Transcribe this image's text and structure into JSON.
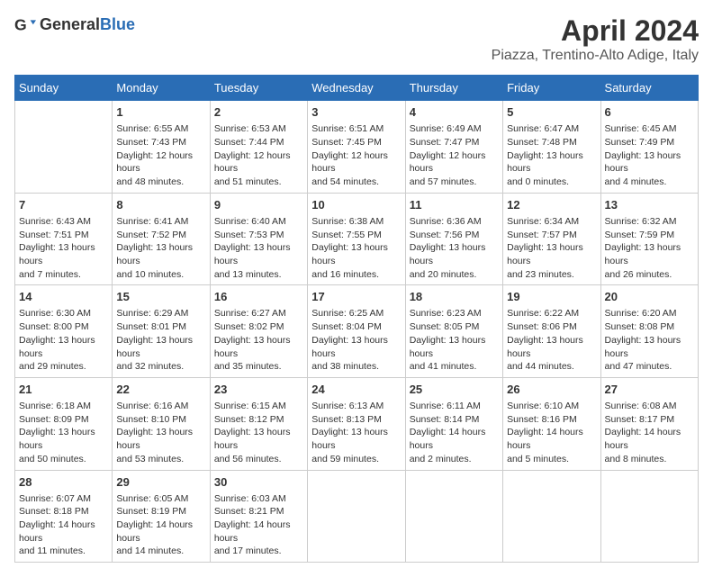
{
  "logo": {
    "general": "General",
    "blue": "Blue"
  },
  "title": "April 2024",
  "location": "Piazza, Trentino-Alto Adige, Italy",
  "days_of_week": [
    "Sunday",
    "Monday",
    "Tuesday",
    "Wednesday",
    "Thursday",
    "Friday",
    "Saturday"
  ],
  "weeks": [
    [
      {
        "day": null,
        "info": null
      },
      {
        "day": "1",
        "info": "Sunrise: 6:55 AM\nSunset: 7:43 PM\nDaylight: 12 hours and 48 minutes."
      },
      {
        "day": "2",
        "info": "Sunrise: 6:53 AM\nSunset: 7:44 PM\nDaylight: 12 hours and 51 minutes."
      },
      {
        "day": "3",
        "info": "Sunrise: 6:51 AM\nSunset: 7:45 PM\nDaylight: 12 hours and 54 minutes."
      },
      {
        "day": "4",
        "info": "Sunrise: 6:49 AM\nSunset: 7:47 PM\nDaylight: 12 hours and 57 minutes."
      },
      {
        "day": "5",
        "info": "Sunrise: 6:47 AM\nSunset: 7:48 PM\nDaylight: 13 hours and 0 minutes."
      },
      {
        "day": "6",
        "info": "Sunrise: 6:45 AM\nSunset: 7:49 PM\nDaylight: 13 hours and 4 minutes."
      }
    ],
    [
      {
        "day": "7",
        "info": "Sunrise: 6:43 AM\nSunset: 7:51 PM\nDaylight: 13 hours and 7 minutes."
      },
      {
        "day": "8",
        "info": "Sunrise: 6:41 AM\nSunset: 7:52 PM\nDaylight: 13 hours and 10 minutes."
      },
      {
        "day": "9",
        "info": "Sunrise: 6:40 AM\nSunset: 7:53 PM\nDaylight: 13 hours and 13 minutes."
      },
      {
        "day": "10",
        "info": "Sunrise: 6:38 AM\nSunset: 7:55 PM\nDaylight: 13 hours and 16 minutes."
      },
      {
        "day": "11",
        "info": "Sunrise: 6:36 AM\nSunset: 7:56 PM\nDaylight: 13 hours and 20 minutes."
      },
      {
        "day": "12",
        "info": "Sunrise: 6:34 AM\nSunset: 7:57 PM\nDaylight: 13 hours and 23 minutes."
      },
      {
        "day": "13",
        "info": "Sunrise: 6:32 AM\nSunset: 7:59 PM\nDaylight: 13 hours and 26 minutes."
      }
    ],
    [
      {
        "day": "14",
        "info": "Sunrise: 6:30 AM\nSunset: 8:00 PM\nDaylight: 13 hours and 29 minutes."
      },
      {
        "day": "15",
        "info": "Sunrise: 6:29 AM\nSunset: 8:01 PM\nDaylight: 13 hours and 32 minutes."
      },
      {
        "day": "16",
        "info": "Sunrise: 6:27 AM\nSunset: 8:02 PM\nDaylight: 13 hours and 35 minutes."
      },
      {
        "day": "17",
        "info": "Sunrise: 6:25 AM\nSunset: 8:04 PM\nDaylight: 13 hours and 38 minutes."
      },
      {
        "day": "18",
        "info": "Sunrise: 6:23 AM\nSunset: 8:05 PM\nDaylight: 13 hours and 41 minutes."
      },
      {
        "day": "19",
        "info": "Sunrise: 6:22 AM\nSunset: 8:06 PM\nDaylight: 13 hours and 44 minutes."
      },
      {
        "day": "20",
        "info": "Sunrise: 6:20 AM\nSunset: 8:08 PM\nDaylight: 13 hours and 47 minutes."
      }
    ],
    [
      {
        "day": "21",
        "info": "Sunrise: 6:18 AM\nSunset: 8:09 PM\nDaylight: 13 hours and 50 minutes."
      },
      {
        "day": "22",
        "info": "Sunrise: 6:16 AM\nSunset: 8:10 PM\nDaylight: 13 hours and 53 minutes."
      },
      {
        "day": "23",
        "info": "Sunrise: 6:15 AM\nSunset: 8:12 PM\nDaylight: 13 hours and 56 minutes."
      },
      {
        "day": "24",
        "info": "Sunrise: 6:13 AM\nSunset: 8:13 PM\nDaylight: 13 hours and 59 minutes."
      },
      {
        "day": "25",
        "info": "Sunrise: 6:11 AM\nSunset: 8:14 PM\nDaylight: 14 hours and 2 minutes."
      },
      {
        "day": "26",
        "info": "Sunrise: 6:10 AM\nSunset: 8:16 PM\nDaylight: 14 hours and 5 minutes."
      },
      {
        "day": "27",
        "info": "Sunrise: 6:08 AM\nSunset: 8:17 PM\nDaylight: 14 hours and 8 minutes."
      }
    ],
    [
      {
        "day": "28",
        "info": "Sunrise: 6:07 AM\nSunset: 8:18 PM\nDaylight: 14 hours and 11 minutes."
      },
      {
        "day": "29",
        "info": "Sunrise: 6:05 AM\nSunset: 8:19 PM\nDaylight: 14 hours and 14 minutes."
      },
      {
        "day": "30",
        "info": "Sunrise: 6:03 AM\nSunset: 8:21 PM\nDaylight: 14 hours and 17 minutes."
      },
      {
        "day": null,
        "info": null
      },
      {
        "day": null,
        "info": null
      },
      {
        "day": null,
        "info": null
      },
      {
        "day": null,
        "info": null
      }
    ]
  ]
}
